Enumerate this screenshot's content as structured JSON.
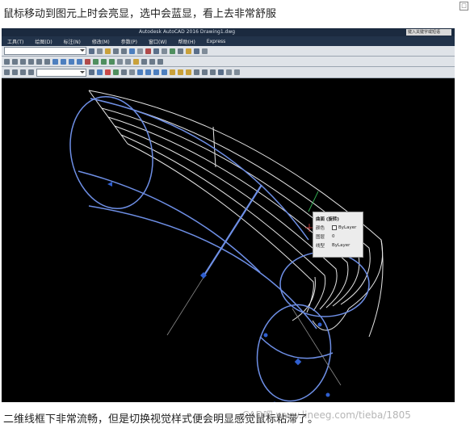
{
  "captions": {
    "top": "鼠标移动到图元上时会亮显，选中会蓝显，看上去非常舒服",
    "bottom": "二维线框下非常流畅，但是切换视觉样式便会明显感觉鼠标粘滞了。"
  },
  "app": {
    "title": "Autodesk AutoCAD 2016    Drawing1.dwg",
    "search_placeholder": "键入关键字或短语"
  },
  "menu": [
    "工具(T)",
    "绘图(D)",
    "标注(N)",
    "修改(M)",
    "参数(P)",
    "窗口(W)",
    "帮助(H)",
    "Express"
  ],
  "tooltip": {
    "title": "曲面 (旋转)",
    "rows": [
      {
        "key": "颜色",
        "value": "ByLayer",
        "swatch": true
      },
      {
        "key": "图层",
        "value": "0"
      },
      {
        "key": "线型",
        "value": "ByLayer"
      }
    ]
  },
  "watermark": "CAD吧 www.lineeg.com/tieba/1805",
  "colors": {
    "selected": "#6e8fe6",
    "highlight": "#e6e6e6",
    "grip": "#2f5fd0",
    "titlebar": "#1b2a3f",
    "menubar": "#22334a",
    "toolbar": "#dfe3e8",
    "canvas": "#000000"
  }
}
